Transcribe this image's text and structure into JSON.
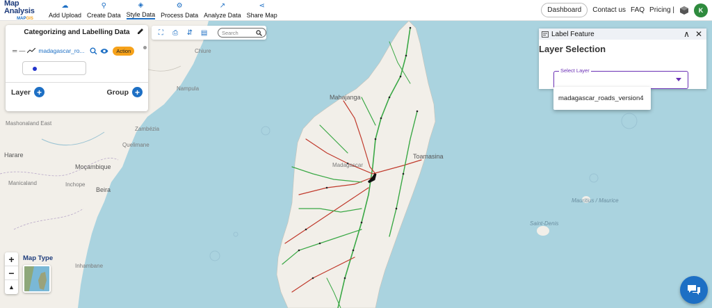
{
  "brand": {
    "title": "Map Analysis",
    "sub_map": "MAP",
    "sub_gis": "GIS"
  },
  "nav": [
    {
      "label": "Add Upload",
      "icon": "cloud-upload-icon"
    },
    {
      "label": "Create Data",
      "icon": "map-pin-icon"
    },
    {
      "label": "Style Data",
      "icon": "paint-bucket-icon"
    },
    {
      "label": "Process Data",
      "icon": "process-icon"
    },
    {
      "label": "Analyze Data",
      "icon": "analyze-icon"
    },
    {
      "label": "Share Map",
      "icon": "share-icon"
    }
  ],
  "top_right": {
    "dashboard": "Dashboard",
    "contact": "Contact us",
    "faq": "FAQ",
    "pricing": "Pricing |",
    "avatar": "K"
  },
  "left_panel": {
    "title": "Categorizing and Labelling Data",
    "layer_name": "madagascar_ro...",
    "action": "Action",
    "layer_label": "Layer",
    "group_label": "Group"
  },
  "map_tools": {
    "search_placeholder": "Search"
  },
  "label_panel": {
    "title": "Label Feature",
    "section": "Layer Selection",
    "select_label": "Select Layer",
    "options": [
      "madagascar_roads_version4"
    ]
  },
  "map_type": {
    "label": "Map Type"
  },
  "map_labels": {
    "mahajanga": "Mahajanga",
    "toamasina": "Toamasina",
    "madagascar": "Madagascar",
    "harare": "Harare",
    "mocambique": "Moçambique",
    "beira": "Beira",
    "quelimane": "Quelimane",
    "chiure": "Chiure",
    "nampula": "Nampula",
    "zambezia": "Zambézia",
    "inhambane": "Inhambane",
    "inhope": "Inchope",
    "manicaland": "Manicaland",
    "mashonaland_east": "Mashonaland East",
    "mauritius": "Mauritius / Maurice",
    "saint_denis": "Saint-Denis"
  },
  "colors": {
    "accent": "#1d6fc4",
    "action": "#f6a21a",
    "select_border": "#6a2fb4",
    "avatar": "#2e8b3e",
    "sea": "#aad3df",
    "land": "#f2efe9"
  }
}
